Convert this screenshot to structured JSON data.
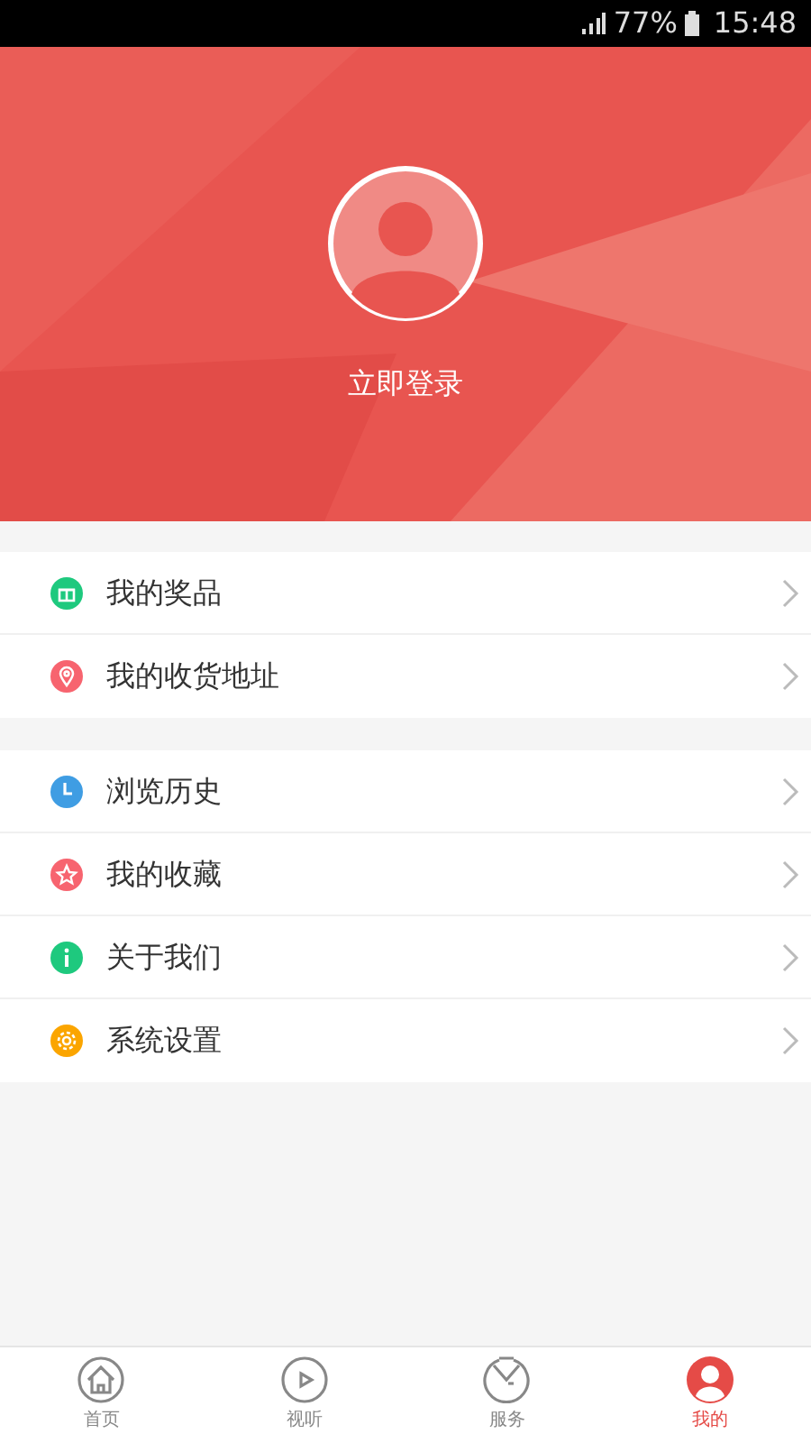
{
  "status_bar": {
    "battery": "77%",
    "time": "15:48"
  },
  "profile": {
    "login": "立即登录"
  },
  "menu_groups": [
    [
      {
        "label": "我的奖品",
        "kind": "gift",
        "color": "#1ec97e"
      },
      {
        "label": "我的收货地址",
        "kind": "pin",
        "color": "#f7646f"
      }
    ],
    [
      {
        "label": "浏览历史",
        "kind": "clock",
        "color": "#3f9de3"
      },
      {
        "label": "我的收藏",
        "kind": "star",
        "color": "#f7646f"
      },
      {
        "label": "关于我们",
        "kind": "info",
        "color": "#1ec97e"
      },
      {
        "label": "系统设置",
        "kind": "gear",
        "color": "#fba500"
      }
    ]
  ],
  "tabs": [
    {
      "label": "首页",
      "kind": "home",
      "selected": false
    },
    {
      "label": "视听",
      "kind": "play",
      "selected": false
    },
    {
      "label": "服务",
      "kind": "service",
      "selected": false
    },
    {
      "label": "我的",
      "kind": "user",
      "selected": true
    }
  ]
}
